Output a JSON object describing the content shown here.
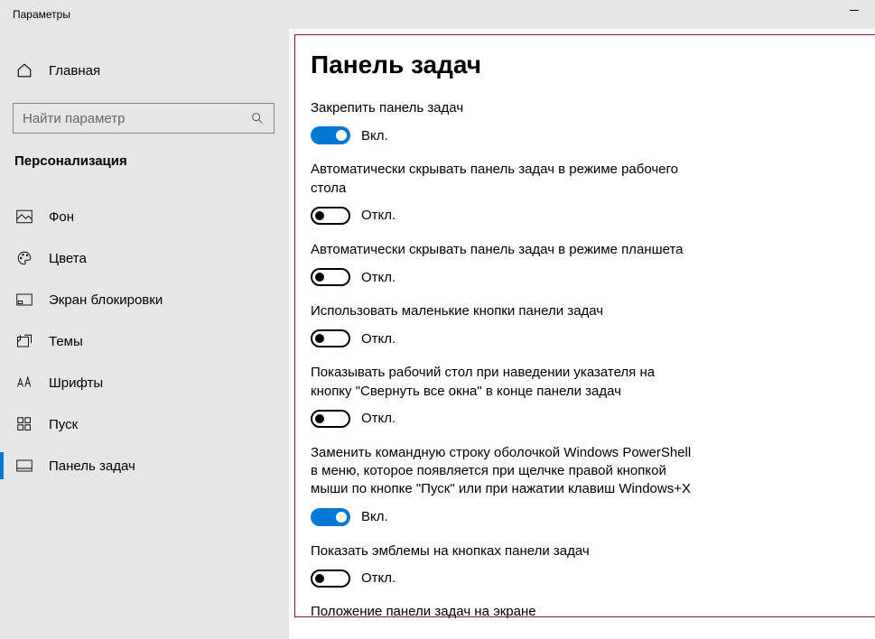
{
  "window": {
    "title": "Параметры"
  },
  "sidebar": {
    "home_label": "Главная",
    "search_placeholder": "Найти параметр",
    "category_title": "Персонализация",
    "items": [
      {
        "label": "Фон"
      },
      {
        "label": "Цвета"
      },
      {
        "label": "Экран блокировки"
      },
      {
        "label": "Темы"
      },
      {
        "label": "Шрифты"
      },
      {
        "label": "Пуск"
      },
      {
        "label": "Панель задач"
      }
    ]
  },
  "main": {
    "heading": "Панель задач",
    "state_on": "Вкл.",
    "state_off": "Откл.",
    "settings": [
      {
        "label": "Закрепить панель задач",
        "value": true
      },
      {
        "label": "Автоматически скрывать панель задач в режиме рабочего стола",
        "value": false
      },
      {
        "label": "Автоматически скрывать панель задач в режиме планшета",
        "value": false
      },
      {
        "label": "Использовать маленькие кнопки панели задач",
        "value": false
      },
      {
        "label": "Показывать рабочий стол при наведении указателя на кнопку \"Свернуть все окна\" в конце панели задач",
        "value": false
      },
      {
        "label": "Заменить командную строку оболочкой Windows PowerShell в меню, которое появляется при щелчке правой кнопкой мыши по кнопке \"Пуск\" или при нажатии клавиш Windows+X",
        "value": true
      },
      {
        "label": "Показать эмблемы на кнопках панели задач",
        "value": false
      }
    ],
    "next_heading": "Положение панели задач на экране"
  }
}
